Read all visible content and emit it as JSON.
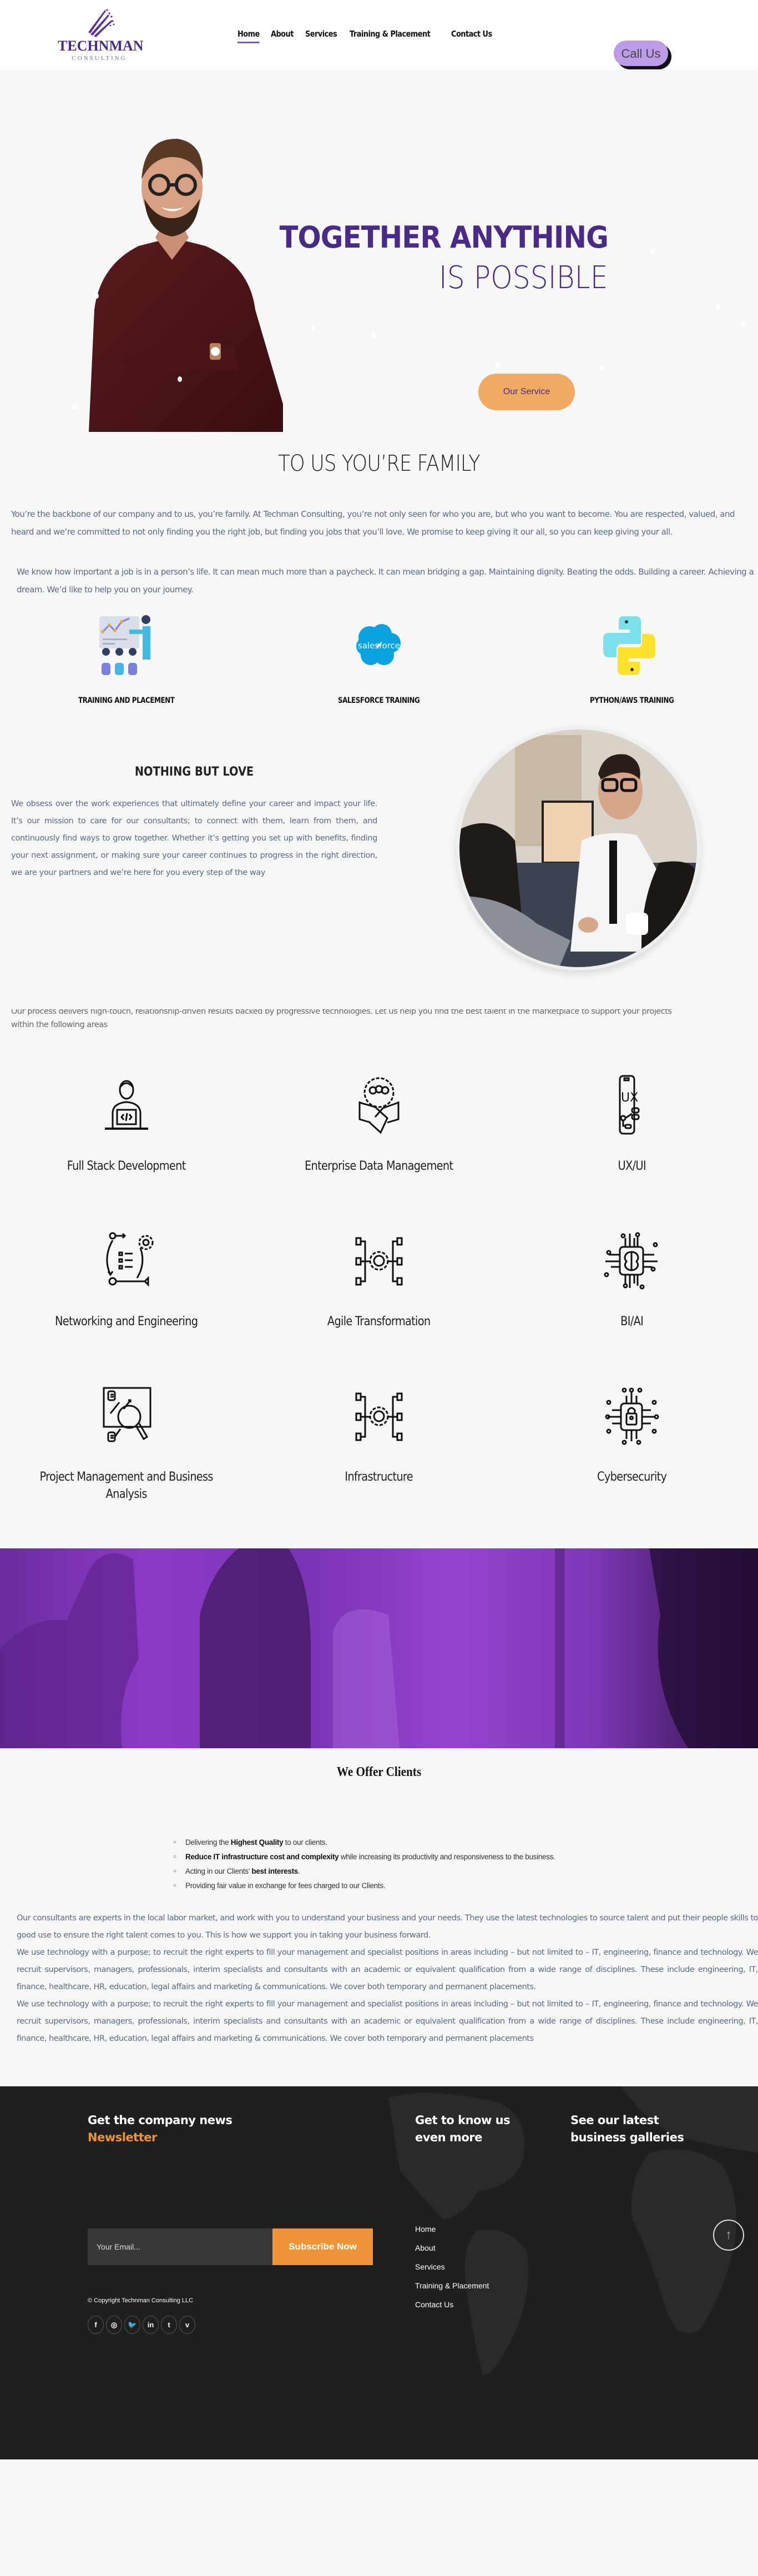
{
  "header": {
    "logo": {
      "name": "TECHNMAN",
      "sub": "CONSULTING"
    },
    "nav": [
      {
        "label": "Home",
        "active": true
      },
      {
        "label": "About",
        "active": false
      },
      {
        "label": "Services",
        "active": false
      },
      {
        "label": "Training & Placement",
        "active": false
      },
      {
        "label": "Contact Us",
        "active": false
      }
    ],
    "call_button": "Call Us"
  },
  "hero": {
    "title_line1": "TOGETHER ANYTHING",
    "title_line2": "IS POSSIBLE",
    "cta": "Our Service"
  },
  "family": {
    "title": "TO US  YOU’RE FAMILY",
    "p1": "You’re the backbone of our company and to us, you’re family. At Techman Consulting, you’re not only seen for who you are, but who you want to become. You are respected, valued, and heard and we’re committed to not only finding you the right job, but finding you jobs that you’ll love. We promise to keep giving it our all, so you can keep giving your all.",
    "p2": "We know how important a job is in a person’s life. It can mean much more than a paycheck. It can mean bridging a gap. Maintaining dignity. Beating the odds. Building a career. Achieving a dream. We’d like to help you on your journey."
  },
  "training": [
    {
      "label": "TRAINING AND PLACEMENT",
      "icon": "presentation-icon"
    },
    {
      "label": "SALESFORCE TRAINING",
      "icon": "salesforce-icon",
      "logo_text": "salesforce"
    },
    {
      "label": "PYTHON/AWS TRAINING",
      "icon": "python-icon"
    }
  ],
  "love": {
    "title": "NOTHING BUT LOVE",
    "text": "We obsess over the work experiences that ultimately define your career and impact your life. It’s our mission to care for our consultants; to connect with them, learn from them, and continuously find ways to grow together. Whether it’s getting you set up with benefits, finding your next assignment, or making sure your career continues to progress in the right direction, we are your partners and we’re here for you every step of the way"
  },
  "areas": {
    "intro_line1": "Our process delivers high-touch, relationship-driven results backed by progressive technologies. Let us help you find the best talent in the marketplace to support your projects",
    "intro_line2": "within the following areas",
    "items": [
      {
        "label": "Full Stack Development",
        "icon": "developer-laptop-icon"
      },
      {
        "label": "Enterprise Data Management",
        "icon": "handshake-gear-icon"
      },
      {
        "label": "UX/UI",
        "icon": "ux-phone-icon"
      },
      {
        "label": "Networking and Engineering",
        "icon": "workflow-gear-icon"
      },
      {
        "label": "Agile Transformation",
        "icon": "gear-network-icon"
      },
      {
        "label": "BI/AI",
        "icon": "brain-chip-icon"
      },
      {
        "label": "Project Management and Business Analysis",
        "icon": "analysis-magnifier-icon"
      },
      {
        "label": "Infrastructure",
        "icon": "gear-network-icon"
      },
      {
        "label": "Cybersecurity",
        "icon": "lock-chip-icon"
      }
    ]
  },
  "offer": {
    "title": "We Offer Clients",
    "list": [
      {
        "pre": "Delivering the ",
        "bold": "Highest Quality",
        "post": " to our clients."
      },
      {
        "pre": "",
        "bold": "Reduce IT infrastructure cost and complexity",
        "post": " while increasing its productivity and responsiveness to the business."
      },
      {
        "pre": "Acting in our Clients’ ",
        "bold": "best interests",
        "post": "."
      },
      {
        "pre": "Providing fair value in exchange for fees charged to our Clients.",
        "bold": "",
        "post": ""
      }
    ],
    "paragraphs": [
      "Our consultants are experts in the local labor market, and work with you to understand your business and your needs. They use the latest technologies to source talent and put their people skills to good use to ensure the right talent comes to you. This is how we support you in taking your business forward.",
      "We use technology with a purpose; to recruit the right experts to fill your management and specialist positions in areas including – but not limited to – IT, engineering, finance and technology. We recruit supervisors, managers, professionals, interim specialists and consultants with an academic or equivalent qualification from a wide range of disciplines. These include engineering, IT, finance, healthcare, HR, education, legal affairs and marketing & communications. We cover both temporary and permanent placements.",
      "We use technology with a purpose; to recruit the right experts to fill your management and specialist positions in areas including – but not limited to – IT, engineering, finance and technology. We recruit supervisors, managers, professionals, interim specialists and consultants with an academic or equivalent qualification from a wide range of disciplines. These include engineering, IT, finance, healthcare, HR, education, legal affairs and marketing & communications. We cover both temporary and permanent placements"
    ]
  },
  "footer": {
    "news_title": "Get the company news",
    "news_accent": "Newsletter",
    "email_placeholder": "Your Email...",
    "subscribe": "Subscribe Now",
    "copyright": "© Copyright Technman Consulting LLC",
    "social": [
      {
        "icon": "facebook-icon",
        "glyph": "f"
      },
      {
        "icon": "instagram-icon",
        "glyph": "◎"
      },
      {
        "icon": "twitter-icon",
        "glyph": "🐦"
      },
      {
        "icon": "linkedin-icon",
        "glyph": "in"
      },
      {
        "icon": "tumblr-icon",
        "glyph": "t"
      },
      {
        "icon": "vimeo-icon",
        "glyph": "v"
      }
    ],
    "know_title": "Get to know us even more",
    "links": [
      "Home",
      "About",
      "Services",
      "Training & Placement",
      "Contact Us"
    ],
    "gallery_title": "See our latest business galleries",
    "back_to_top": "↑"
  },
  "colors": {
    "brand_purple": "#4a2a87",
    "accent_orange": "#ef9339",
    "call_button": "#bd9be6",
    "footer_bg": "#1f1f1f",
    "page_bg": "#f7f7f7"
  }
}
